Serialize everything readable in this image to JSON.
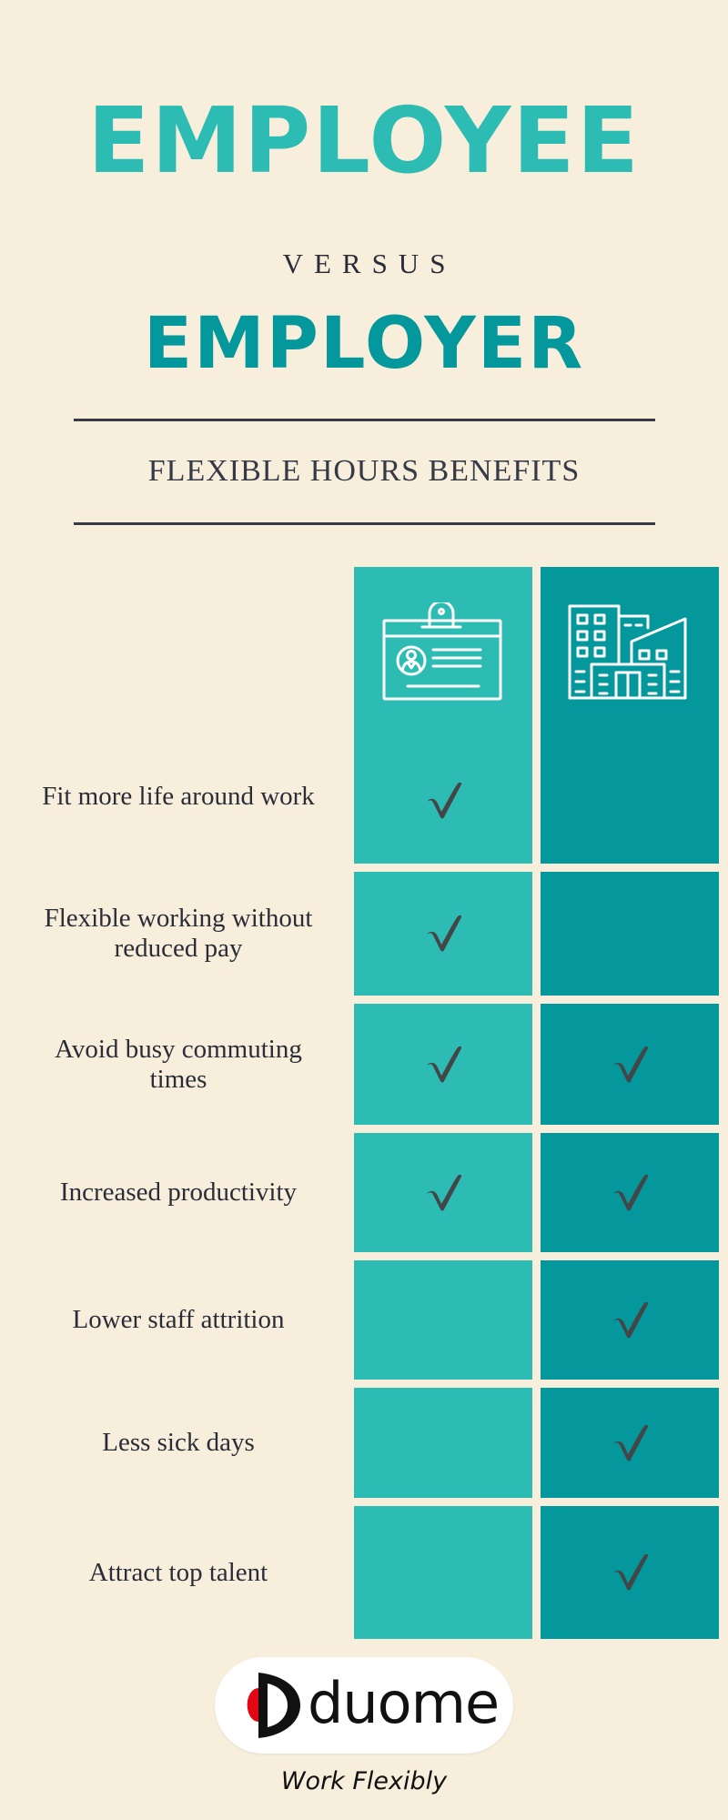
{
  "header": {
    "title_primary": "EMPLOYEE",
    "connector": "VERSUS",
    "title_secondary": "EMPLOYER",
    "subtitle": "FLEXIBLE HOURS BENEFITS"
  },
  "colors": {
    "background": "#f7eedc",
    "employee_teal": "#2dbcb4",
    "employer_teal": "#04979b",
    "text_dark": "#2a2d38",
    "rule": "#363a47",
    "checkmark": "#434547",
    "logo_red": "#e30613"
  },
  "columns": [
    {
      "key": "employee",
      "icon": "id-badge-icon"
    },
    {
      "key": "employer",
      "icon": "office-building-icon"
    }
  ],
  "benefits": [
    {
      "label": "Fit more life around work",
      "employee": true,
      "employer": false
    },
    {
      "label": "Flexible working without reduced pay",
      "employee": true,
      "employer": false
    },
    {
      "label": "Avoid busy commuting times",
      "employee": true,
      "employer": true
    },
    {
      "label": "Increased productivity",
      "employee": true,
      "employer": true
    },
    {
      "label": "Lower staff attrition",
      "employee": false,
      "employer": true
    },
    {
      "label": "Less sick days",
      "employee": false,
      "employer": true
    },
    {
      "label": "Attract top talent",
      "employee": false,
      "employer": true
    }
  ],
  "footer": {
    "logo_text": "duome",
    "tagline": "Work Flexibly"
  }
}
